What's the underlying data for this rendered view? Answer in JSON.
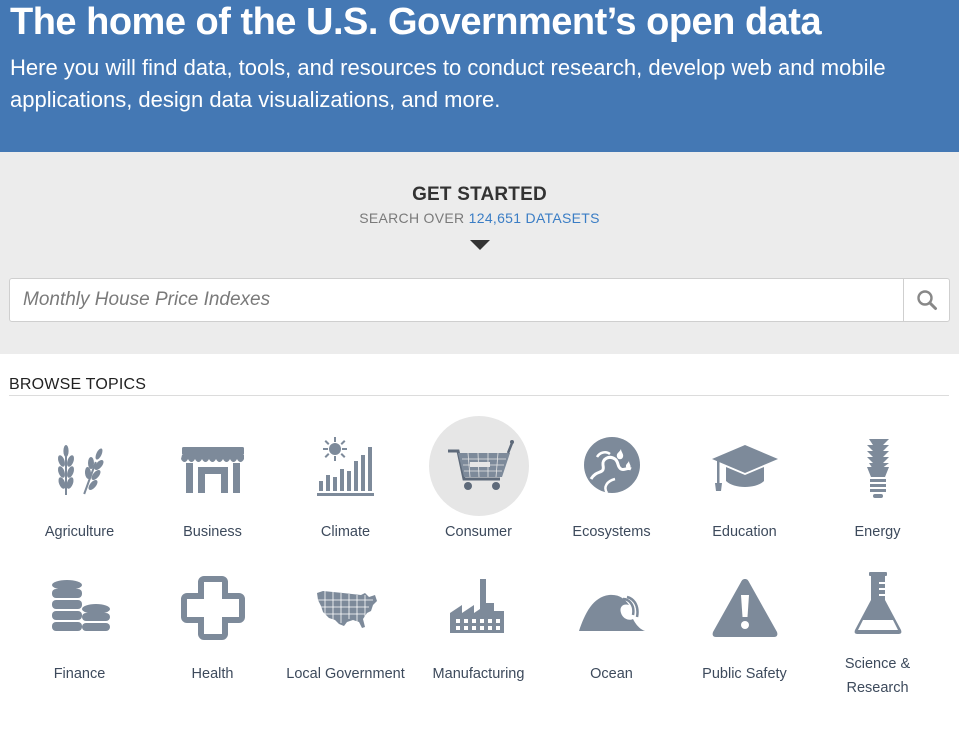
{
  "hero": {
    "title": "The home of the U.S. Government’s open data",
    "subtitle": "Here you will find data, tools, and resources to conduct research, develop web and mobile applications, design data visualizations, and more."
  },
  "get_started": {
    "heading": "GET STARTED",
    "search_over_prefix": "SEARCH OVER",
    "dataset_count": "124,651 DATASETS"
  },
  "search": {
    "placeholder": "Monthly House Price Indexes",
    "button_icon": "search-icon"
  },
  "browse": {
    "title": "BROWSE TOPICS",
    "topics": [
      {
        "label": "Agriculture",
        "icon": "agriculture-icon"
      },
      {
        "label": "Business",
        "icon": "business-icon"
      },
      {
        "label": "Climate",
        "icon": "climate-icon"
      },
      {
        "label": "Consumer",
        "icon": "consumer-icon",
        "active": true
      },
      {
        "label": "Ecosystems",
        "icon": "ecosystems-icon"
      },
      {
        "label": "Education",
        "icon": "education-icon"
      },
      {
        "label": "Energy",
        "icon": "energy-icon"
      },
      {
        "label": "Finance",
        "icon": "finance-icon"
      },
      {
        "label": "Health",
        "icon": "health-icon"
      },
      {
        "label": "Local Government",
        "icon": "local-government-icon"
      },
      {
        "label": "Manufacturing",
        "icon": "manufacturing-icon"
      },
      {
        "label": "Ocean",
        "icon": "ocean-icon"
      },
      {
        "label": "Public Safety",
        "icon": "public-safety-icon"
      },
      {
        "label": "Science & Research",
        "icon": "science-research-icon"
      }
    ]
  },
  "colors": {
    "hero_bg": "#4478b4",
    "accent_link": "#3a7dc5",
    "icon_gray": "#7d8a9a",
    "band_bg": "#ececec"
  }
}
